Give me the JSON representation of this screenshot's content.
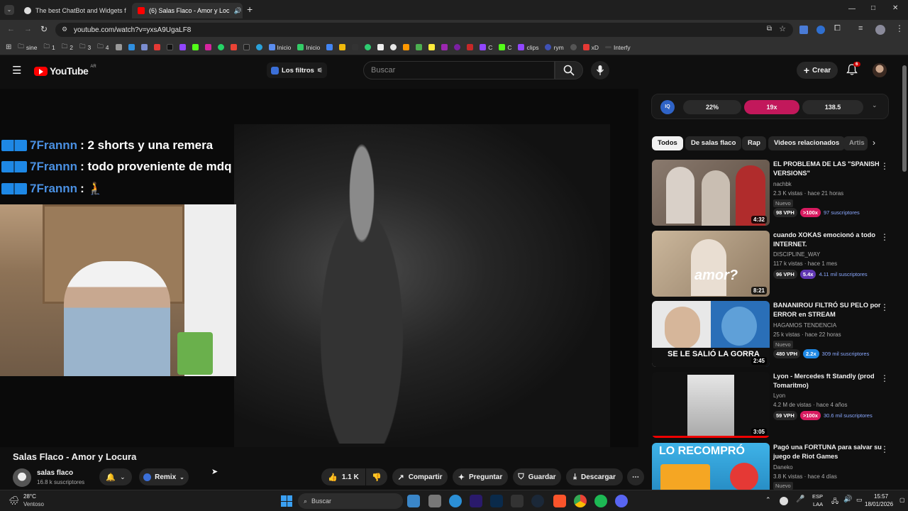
{
  "browser": {
    "tabs": [
      {
        "title": "The best ChatBot and Widgets f",
        "active": false
      },
      {
        "title": "(6) Salas Flaco - Amor y Loc",
        "active": true
      }
    ],
    "new_tab": "+",
    "url": "youtube.com/watch?v=yxsA9UgaLF8",
    "window_controls": [
      "—",
      "□",
      "✕"
    ],
    "bookmarks": [
      {
        "label": "sine",
        "type": "folder"
      },
      {
        "label": "1",
        "type": "folder"
      },
      {
        "label": "2",
        "type": "folder"
      },
      {
        "label": "3",
        "type": "folder"
      },
      {
        "label": "4",
        "type": "folder"
      },
      {
        "label": "Inicio",
        "type": "site"
      },
      {
        "label": "Inicio",
        "type": "site"
      },
      {
        "label": "C",
        "type": "site"
      },
      {
        "label": "C",
        "type": "site"
      },
      {
        "label": "clips",
        "type": "site"
      },
      {
        "label": "rym",
        "type": "site"
      },
      {
        "label": "xD",
        "type": "site"
      },
      {
        "label": "Interfy",
        "type": "site"
      }
    ]
  },
  "youtube": {
    "logo": "YouTube",
    "region": "AR",
    "filters_label": "Los filtros",
    "search_placeholder": "Buscar",
    "create_label": "Crear",
    "notif_count": "6"
  },
  "video": {
    "chat": [
      {
        "user": "7Frannn",
        "text": ": 2 shorts y una remera"
      },
      {
        "user": "7Frannn",
        "text": ": todo proveniente de mdq"
      },
      {
        "user": "7Frannn",
        "text": ": 🧎"
      }
    ],
    "title": "Salas Flaco - Amor y Locura",
    "channel": "salas flaco",
    "subscribers": "16.8 k suscriptores",
    "remix_label": "Remix",
    "likes": "1.1 K",
    "actions": [
      "Compartir",
      "Preguntar",
      "Guardar",
      "Descargar"
    ]
  },
  "iq_bar": {
    "badge": "IQ",
    "stat1": "22%",
    "stat2": "19x",
    "stat3": "138.5"
  },
  "chips": [
    "Todos",
    "De salas flaco",
    "Rap",
    "Videos relacionados",
    "Artis"
  ],
  "recommendations": [
    {
      "title": "EL PROBLEMA DE LAS \"SPANISH VERSIONS\"",
      "channel": "nachbk",
      "meta": "2.3 K vistas · hace 21 horas",
      "nuevo": "Nuevo",
      "vph": "98 VPH",
      "mult": ">100x",
      "mult_color": "#d81b60",
      "subs": "97 suscriptores",
      "duration": "4:32",
      "thumb": "#7a6a60"
    },
    {
      "title": "cuando XOKAS emocionó a todo INTERNET.",
      "channel": "DISCIPLINE_WAY",
      "meta": "117 k vistas · hace 1 mes",
      "nuevo": "",
      "vph": "96 VPH",
      "mult": "5.4x",
      "mult_color": "#5e35b1",
      "subs": "4.11 mil suscriptores",
      "duration": "8:21",
      "thumb": "#b9a48a",
      "overlay": "amor?"
    },
    {
      "title": "BANANIROU FILTRÓ SU PELO por ERROR en STREAM",
      "channel": "HAGAMOS TENDENCIA",
      "meta": "25 k vistas · hace 22 horas",
      "nuevo": "Nuevo",
      "vph": "480 VPH",
      "mult": "2.2x",
      "mult_color": "#1e88e5",
      "subs": "309 mil suscriptores",
      "duration": "2:45",
      "thumb": "#3a5f8a",
      "overlay": "SE LE SALIÓ LA GORRA"
    },
    {
      "title": "Lyon - Mercedes ft Standly (prod Tomaritmo)",
      "channel": "Lyon",
      "meta": "4.2 M de vistas · hace 4 años",
      "nuevo": "",
      "vph": "59 VPH",
      "mult": ">100x",
      "mult_color": "#d81b60",
      "subs": "30.6 mil suscriptores",
      "duration": "3:05",
      "thumb": "#1a1a1a"
    },
    {
      "title": "Pagó una FORTUNA para salvar su juego de Riot Games",
      "channel": "Daneko",
      "meta": "3.8 K vistas · hace 4 días",
      "nuevo": "Nuevo",
      "vph": "",
      "mult": "",
      "mult_color": "",
      "subs": "",
      "duration": "",
      "thumb": "#2aa0d8",
      "overlay": "LO RECOMPRÓ"
    }
  ],
  "taskbar": {
    "temp": "28°C",
    "weather": "Ventoso",
    "search": "Buscar",
    "lang": "ESP",
    "lang2": "LAA",
    "time": "15:57",
    "date": "18/01/2026"
  }
}
